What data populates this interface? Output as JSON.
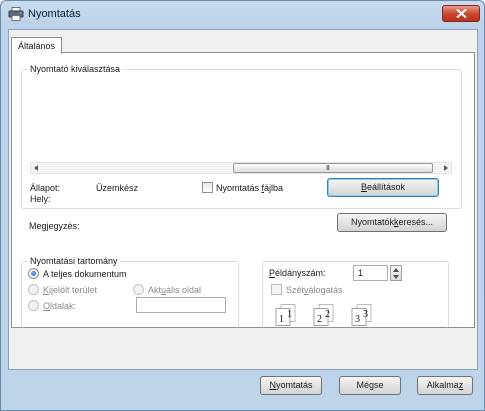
{
  "window": {
    "title": "Nyomtatás"
  },
  "tabs": [
    {
      "label": "Általános"
    }
  ],
  "printer_section": {
    "title": "Nyomtató kiválasztása",
    "status_label": "Állapot:",
    "status_value": "Üzemkész",
    "location_label": "Hely:",
    "comment_label_pre": "Me",
    "comment_label_ul": "g",
    "comment_label_post": "jegyzés:",
    "scrollbar_grip": "III",
    "print_to_file_pre": "Nyomtatás ",
    "print_to_file_ul": "f",
    "print_to_file_post": "ájlba",
    "print_to_file_checked": false,
    "preferences_ul": "B",
    "preferences_post": "eállítások",
    "find_printer_pre": "Nyomtatók",
    "find_printer_ul": "k",
    "find_printer_post": "eresés..."
  },
  "range_section": {
    "title": "Nyomtatási tartomány",
    "all_pre": "A tel",
    "all_ul": "j",
    "all_post": "es dokumentum",
    "selection_ul": "K",
    "selection_post": "ijelölt terület",
    "current_pre": "Akt",
    "current_ul": "u",
    "current_post": "ális oldal",
    "pages_ul": "O",
    "pages_post": "ldalak:",
    "pages_value": "",
    "selected_option": "all"
  },
  "copies_section": {
    "copies_ul": "P",
    "copies_post": "éldányszám:",
    "copies_value": "1",
    "collate_pre": "Szét",
    "collate_ul": "v",
    "collate_post": "álogatás",
    "collate_checked": false
  },
  "footer": {
    "print_ul": "N",
    "print_post": "yomtatás",
    "cancel_label": "Mégse",
    "apply_pre": "Alkalma",
    "apply_ul": "z"
  },
  "colors": {
    "title_bar": "#bcd2ea",
    "close_button": "#c6442d",
    "default_button_border": "#3c7fb1"
  }
}
